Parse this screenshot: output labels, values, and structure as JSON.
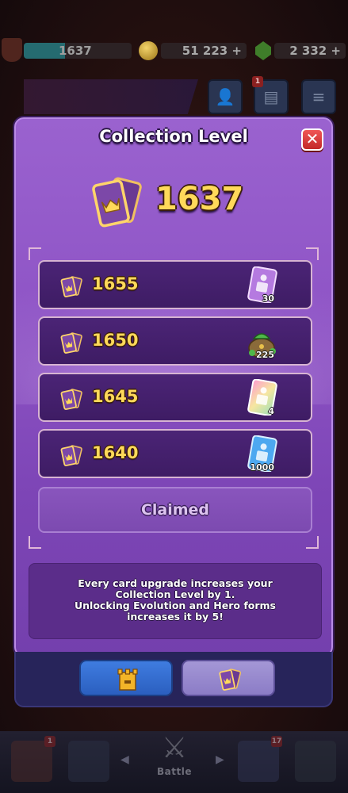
{
  "hud": {
    "king_level_value": "1637",
    "gold_value": "51 223 +",
    "gems_value": "2 332 +",
    "notification_count": "1"
  },
  "modal": {
    "title": "Collection Level",
    "close_label": "✕",
    "current_level": "1637",
    "rewards": [
      {
        "level": "1655",
        "reward": "card",
        "quantity": "30",
        "color": "#c58ae8"
      },
      {
        "level": "1650",
        "reward": "gold-bag",
        "quantity": "225",
        "color": "#4fb84a"
      },
      {
        "level": "1645",
        "reward": "card",
        "quantity": "4",
        "color": "#f0b0d8"
      },
      {
        "level": "1640",
        "reward": "card",
        "quantity": "1000",
        "color": "#4da8f0"
      }
    ],
    "claimed_label": "Claimed",
    "info_lines": [
      "Every card upgrade increases your",
      "Collection Level by 1.",
      "Unlocking Evolution and Hero forms",
      "increases it by 5!"
    ]
  },
  "bottom_nav": {
    "battle_label": "Battle",
    "shop_badge": "1",
    "clan_badge": "17"
  },
  "colors": {
    "modal_purple": "#8f55c6",
    "level_gold": "#ffd95a",
    "row_dark": "#3e1c64",
    "tab_blue": "#3f7ce0",
    "tab_lilac": "#a497d6"
  }
}
